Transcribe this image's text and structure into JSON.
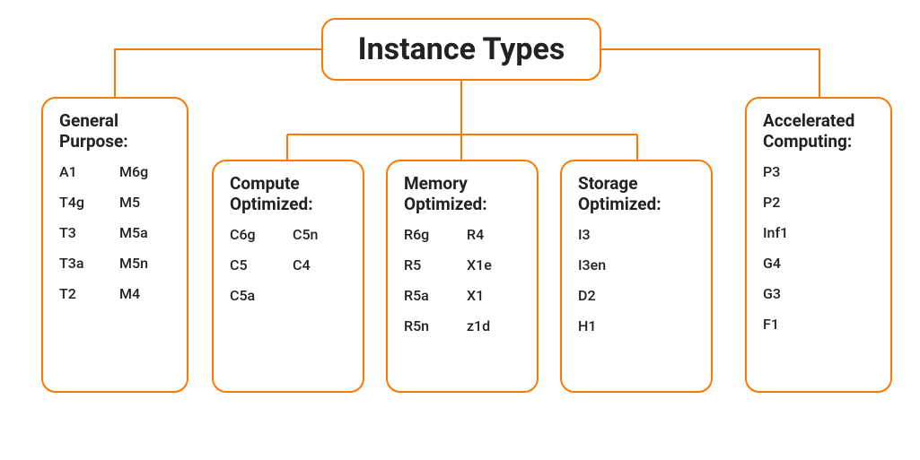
{
  "root": {
    "title": "Instance Types"
  },
  "colors": {
    "accent": "#ff7900",
    "text": "#222222"
  },
  "categories": [
    {
      "id": "general",
      "title": "General Purpose:",
      "layout": "two-col",
      "items": [
        "A1",
        "M6g",
        "T4g",
        "M5",
        "T3",
        "M5a",
        "T3a",
        "M5n",
        "T2",
        "M4"
      ]
    },
    {
      "id": "compute",
      "title": "Compute Optimized:",
      "layout": "two-col",
      "items": [
        "C6g",
        "C5n",
        "C5",
        "C4",
        "C5a",
        ""
      ]
    },
    {
      "id": "memory",
      "title": "Memory Optimized:",
      "layout": "two-col",
      "items": [
        "R6g",
        "R4",
        "R5",
        "X1e",
        "R5a",
        "X1",
        "R5n",
        "z1d"
      ]
    },
    {
      "id": "storage",
      "title": "Storage Optimized:",
      "layout": "one-col",
      "items": [
        "I3",
        "I3en",
        "D2",
        "H1"
      ]
    },
    {
      "id": "accel",
      "title": "Accelerated Computing:",
      "layout": "one-col",
      "items": [
        "P3",
        "P2",
        "Inf1",
        "G4",
        "G3",
        "F1"
      ]
    }
  ]
}
